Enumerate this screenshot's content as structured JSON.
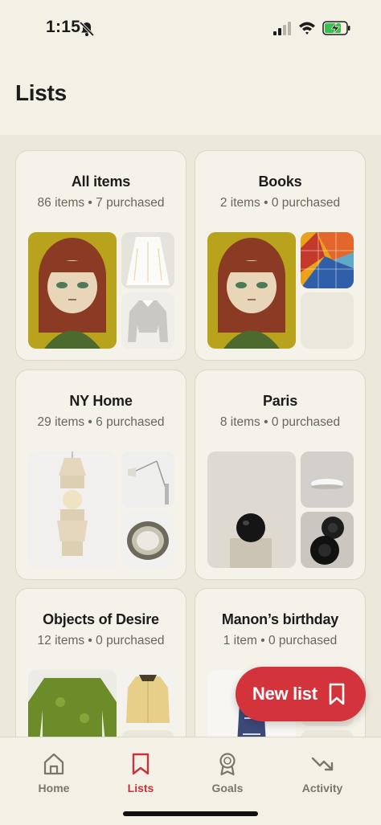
{
  "status_bar": {
    "time": "1:15"
  },
  "header": {
    "title": "Lists"
  },
  "lists": [
    {
      "title": "All items",
      "subtitle": "86 items • 7 purchased"
    },
    {
      "title": "Books",
      "subtitle": "2 items • 0 purchased"
    },
    {
      "title": "NY Home",
      "subtitle": "29 items • 6 purchased"
    },
    {
      "title": "Paris",
      "subtitle": "8 items • 0 purchased"
    },
    {
      "title": "Objects of Desire",
      "subtitle": "12 items • 0 purchased"
    },
    {
      "title": "Manon’s birthday",
      "subtitle": "1 item • 0 purchased"
    }
  ],
  "fab": {
    "label": "New list",
    "icon": "bookmark-icon"
  },
  "tabbar": {
    "tabs": [
      {
        "label": "Home",
        "icon": "home-icon"
      },
      {
        "label": "Lists",
        "icon": "bookmark-icon",
        "active": true
      },
      {
        "label": "Goals",
        "icon": "award-icon"
      },
      {
        "label": "Activity",
        "icon": "trend-down-icon"
      }
    ]
  },
  "colors": {
    "accent": "#d3333b",
    "background": "#ece8dc",
    "card": "#f5f2e9"
  }
}
